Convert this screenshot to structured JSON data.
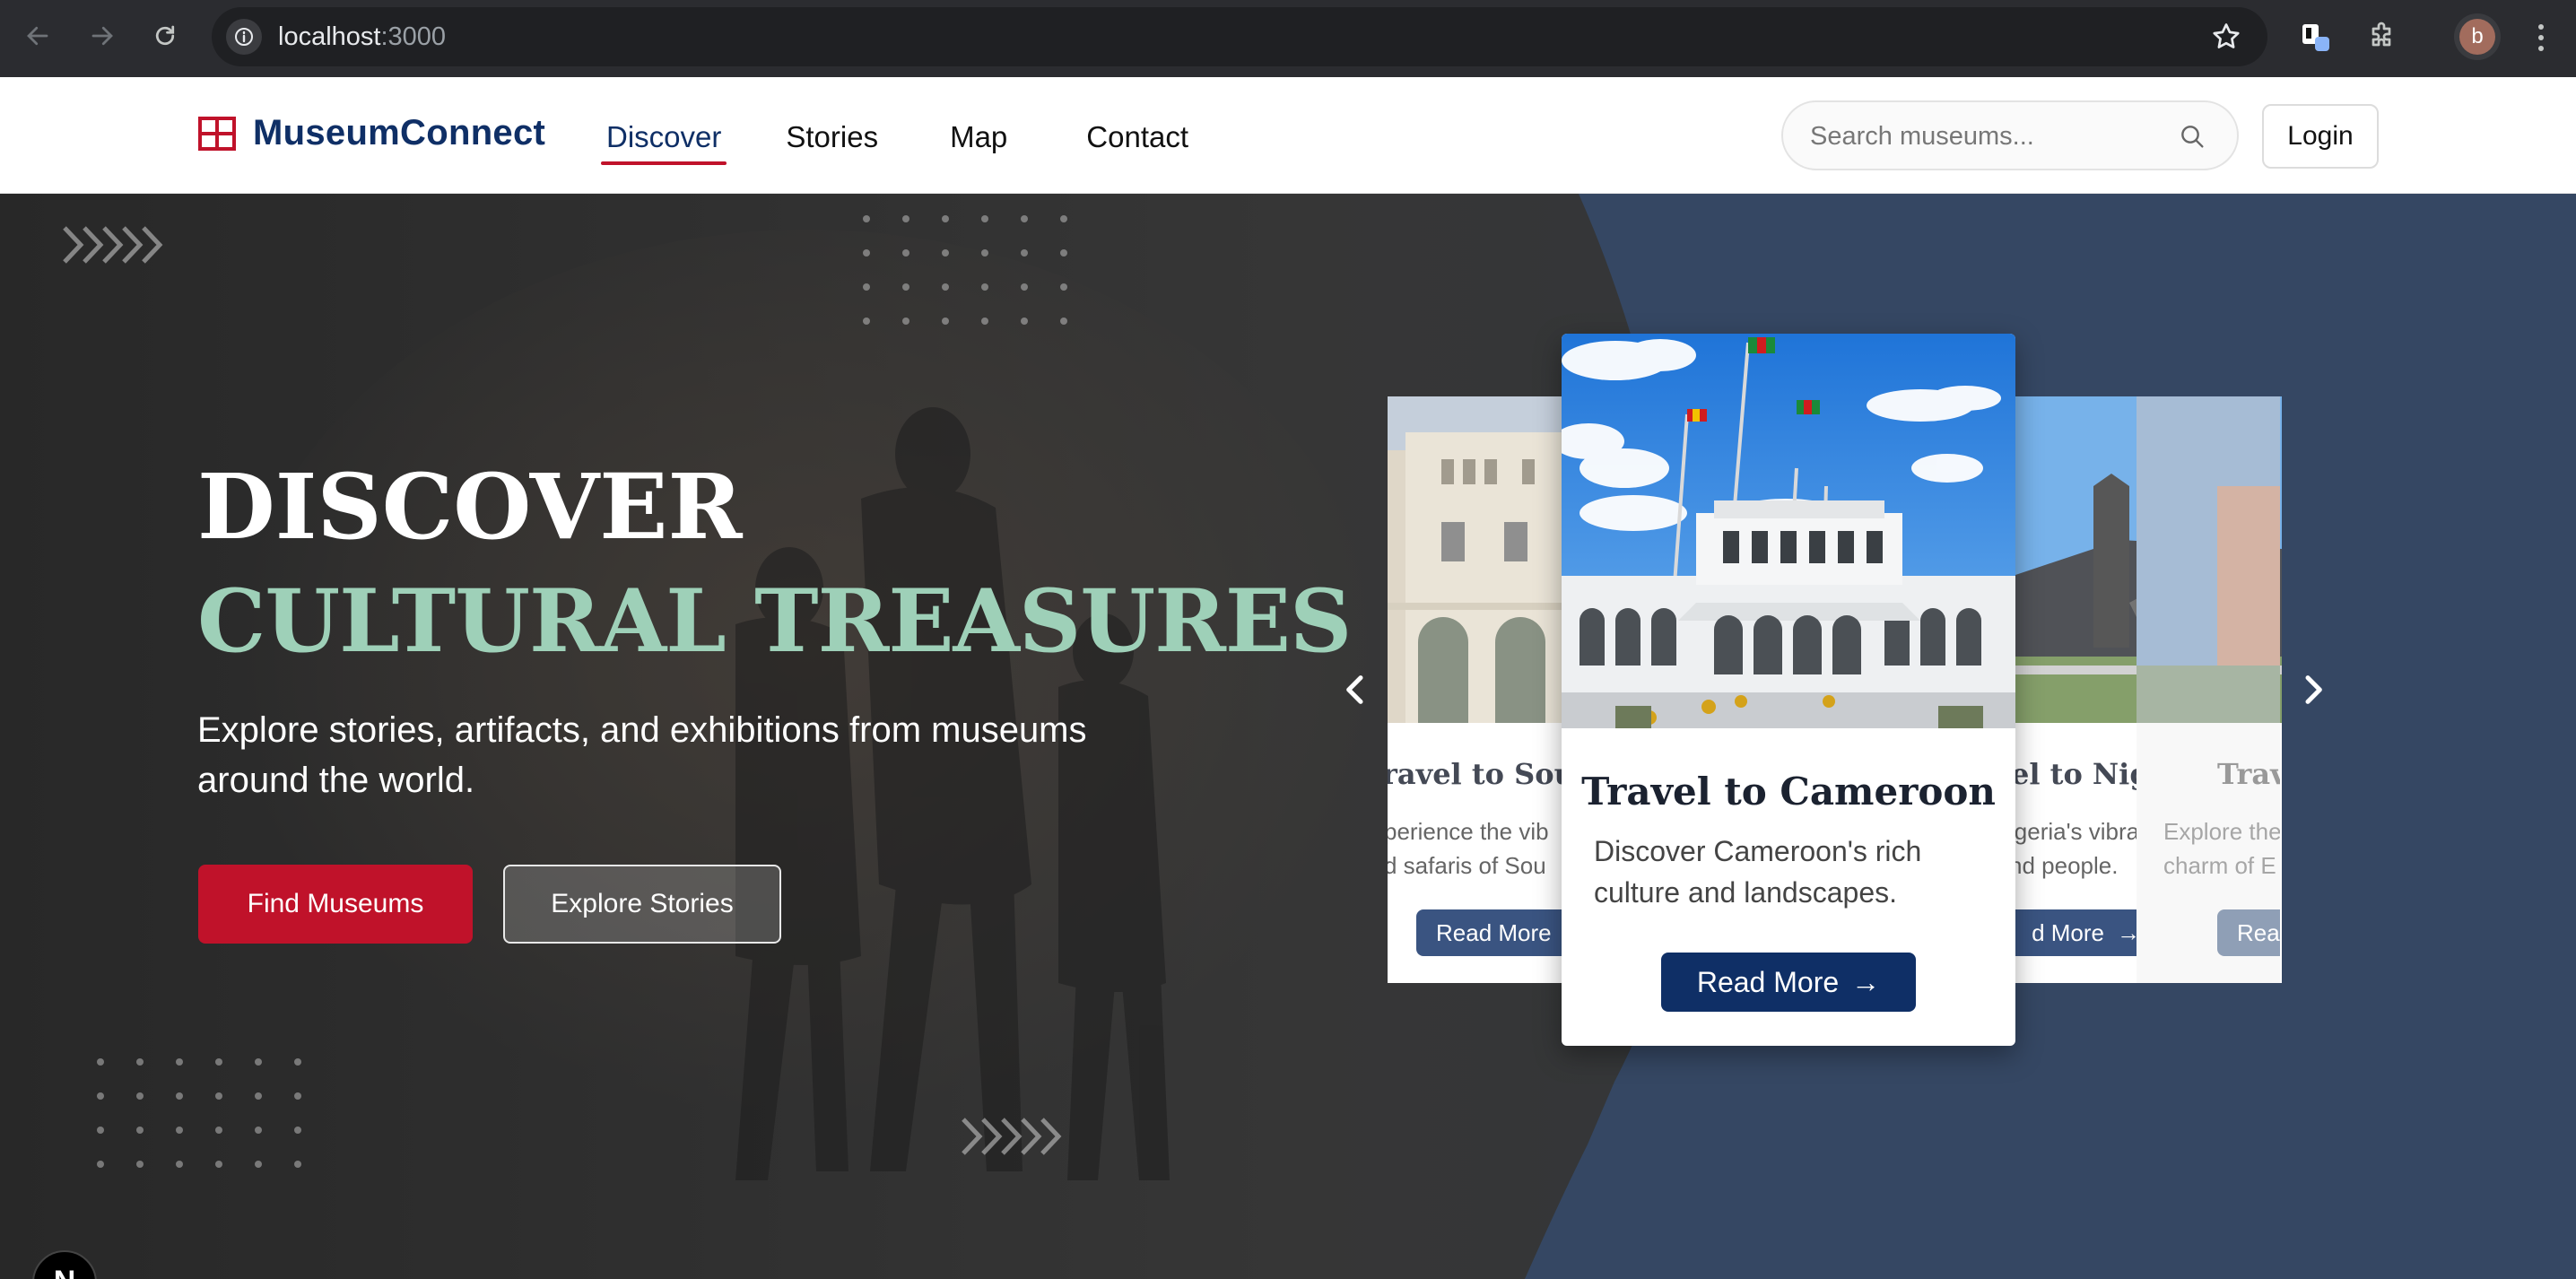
{
  "browser": {
    "url_host": "localhost",
    "url_port": ":3000",
    "profile_initial": "b"
  },
  "header": {
    "brand": "MuseumConnect",
    "nav": [
      {
        "label": "Discover",
        "active": true
      },
      {
        "label": "Stories",
        "active": false
      },
      {
        "label": "Map",
        "active": false
      },
      {
        "label": "Contact",
        "active": false
      }
    ],
    "search_placeholder": "Search museums...",
    "login_label": "Login"
  },
  "hero": {
    "title_line1": "DISCOVER",
    "title_line2": "CULTURAL TREASURES",
    "subtitle": "Explore stories, artifacts, and exhibitions from museums around the world.",
    "primary_button": "Find Museums",
    "secondary_button": "Explore Stories"
  },
  "carousel": {
    "main": {
      "title": "Travel to Cameroon",
      "description": "Discover Cameroon's rich culture and landscapes.",
      "button": "Read More",
      "arrow": "→"
    },
    "left": {
      "title": "ravel to Sout",
      "description_line1": "perience the vib",
      "description_line2": "d safaris of Sou",
      "button": "Read More"
    },
    "right": {
      "title": "el to Nigeria",
      "description_line1": "igeria's vibrant",
      "description_line2": "nd people.",
      "button": "d More",
      "arrow": "→"
    },
    "far_right": {
      "title": "Trav",
      "description_line1": "Explore the",
      "description_line2": "charm of E",
      "button": "Rea"
    }
  },
  "colors": {
    "brand_navy": "#0f2f66",
    "brand_red": "#c0122a",
    "accent_mint": "#9ed0b8"
  },
  "dev_badge": "N"
}
